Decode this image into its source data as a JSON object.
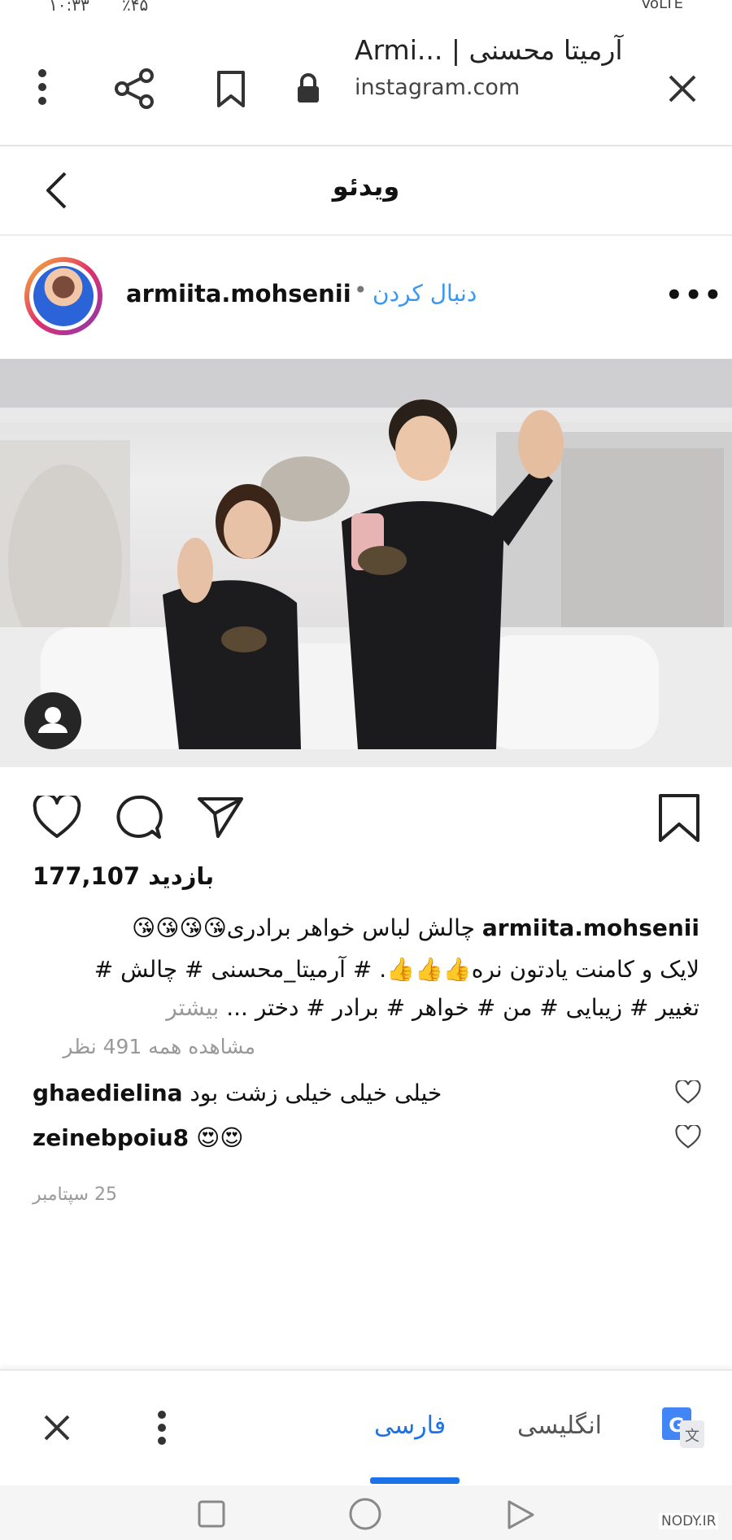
{
  "status_bar": {
    "time": "۱۰:۳۳",
    "battery": "٪۴۵",
    "network": "VoLTE"
  },
  "browser": {
    "title": "Armi... | آرمیتا محسنی",
    "url": "instagram.com"
  },
  "page": {
    "title": "ویدئو"
  },
  "post": {
    "username": "armiita.mohsenii",
    "follow_label": "دنبال کردن",
    "dot": "•",
    "more": "•••",
    "views": "177,107",
    "views_label": "بازدید",
    "caption_line1": "چالش لباس خواهر برادری😘😘😘😘",
    "caption_line2": "لایک و کامنت یادتون نره👍👍👍. # آرمیتا_محسنی # چالش #",
    "caption_line3": "تغییر # زیبایی # من # خواهر # برادر # دختر ...",
    "more_label": "بیشتر",
    "view_all_comments": "مشاهده همه 491 نظر",
    "comments": [
      {
        "user": "ghaedielina",
        "text": "خیلی خیلی خیلی زشت بود"
      },
      {
        "user": "zeinebpoiu8",
        "text": "😍😍"
      }
    ],
    "date": "25 سپتامبر"
  },
  "translate_bar": {
    "farsi": "فارسی",
    "english": "انگلیسی"
  },
  "watermark": "NODY.IR",
  "colors": {
    "link_blue": "#3897f0",
    "translate_blue": "#1a73e8",
    "text": "#111111",
    "muted": "#999999"
  }
}
